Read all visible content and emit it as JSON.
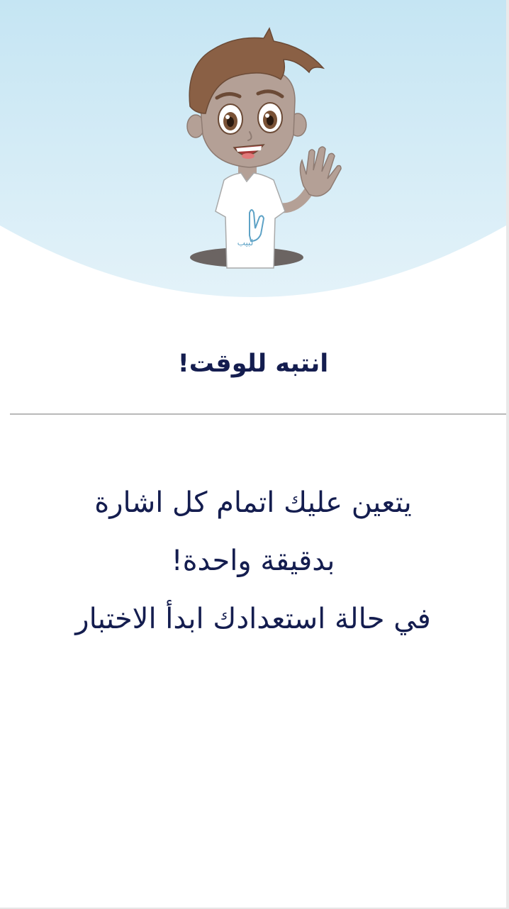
{
  "header": {
    "mascot_icon": "waving-boy-mascot",
    "shirt_logo_text": "لبيب",
    "background_top_color": "#c5e5f3",
    "background_bottom_color": "#e3f2f9"
  },
  "dialog": {
    "title": "انتبه للوقت!",
    "message_lines": [
      "يتعين عليك اتمام كل اشارة",
      "بدقيقة واحدة!",
      "في حالة استعدادك ابدأ الاختبار"
    ],
    "text_color": "#141d4f"
  }
}
